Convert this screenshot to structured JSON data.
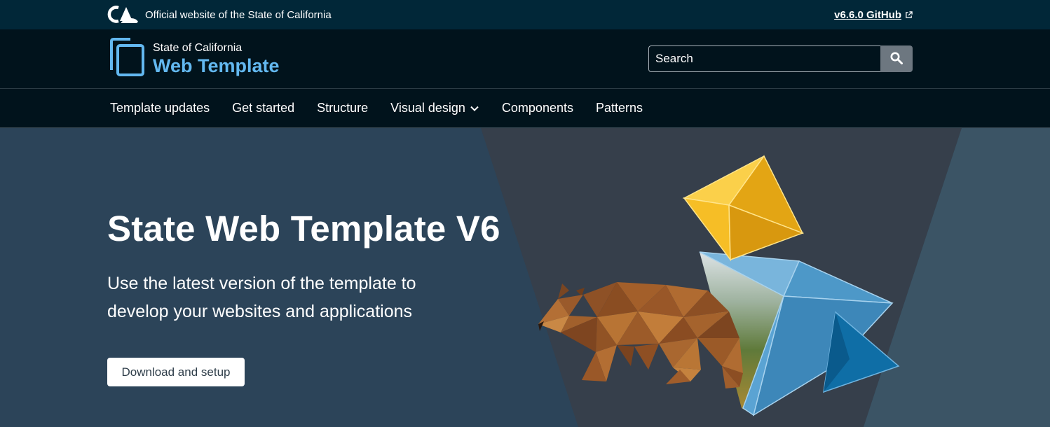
{
  "utility": {
    "official_text": "Official website of the State of California",
    "github_link": "v6.6.0 GitHub",
    "ca_logo_icon": "ca-logo-icon",
    "external_icon": "external-link-icon"
  },
  "branding": {
    "org": "State of California",
    "title": "Web Template",
    "logo_icon": "web-template-logo-icon"
  },
  "search": {
    "placeholder": "Search",
    "icon": "search-icon"
  },
  "nav": {
    "items": [
      {
        "label": "Template updates"
      },
      {
        "label": "Get started"
      },
      {
        "label": "Structure"
      },
      {
        "label": "Visual design",
        "has_dropdown": true
      },
      {
        "label": "Components"
      },
      {
        "label": "Patterns"
      }
    ]
  },
  "hero": {
    "title": "State Web Template V6",
    "subtitle": "Use the latest version of the template to develop your websites and applications",
    "button_label": "Download and setup"
  },
  "colors": {
    "utility_bg": "#012738",
    "branding_bg": "#01131c",
    "hero_bg": "#2c4459",
    "brand_accent": "#63b8f0",
    "gold": "#f4b81e",
    "sky_blue": "#4a9ed4",
    "bear_brown": "#9a5a2b"
  }
}
